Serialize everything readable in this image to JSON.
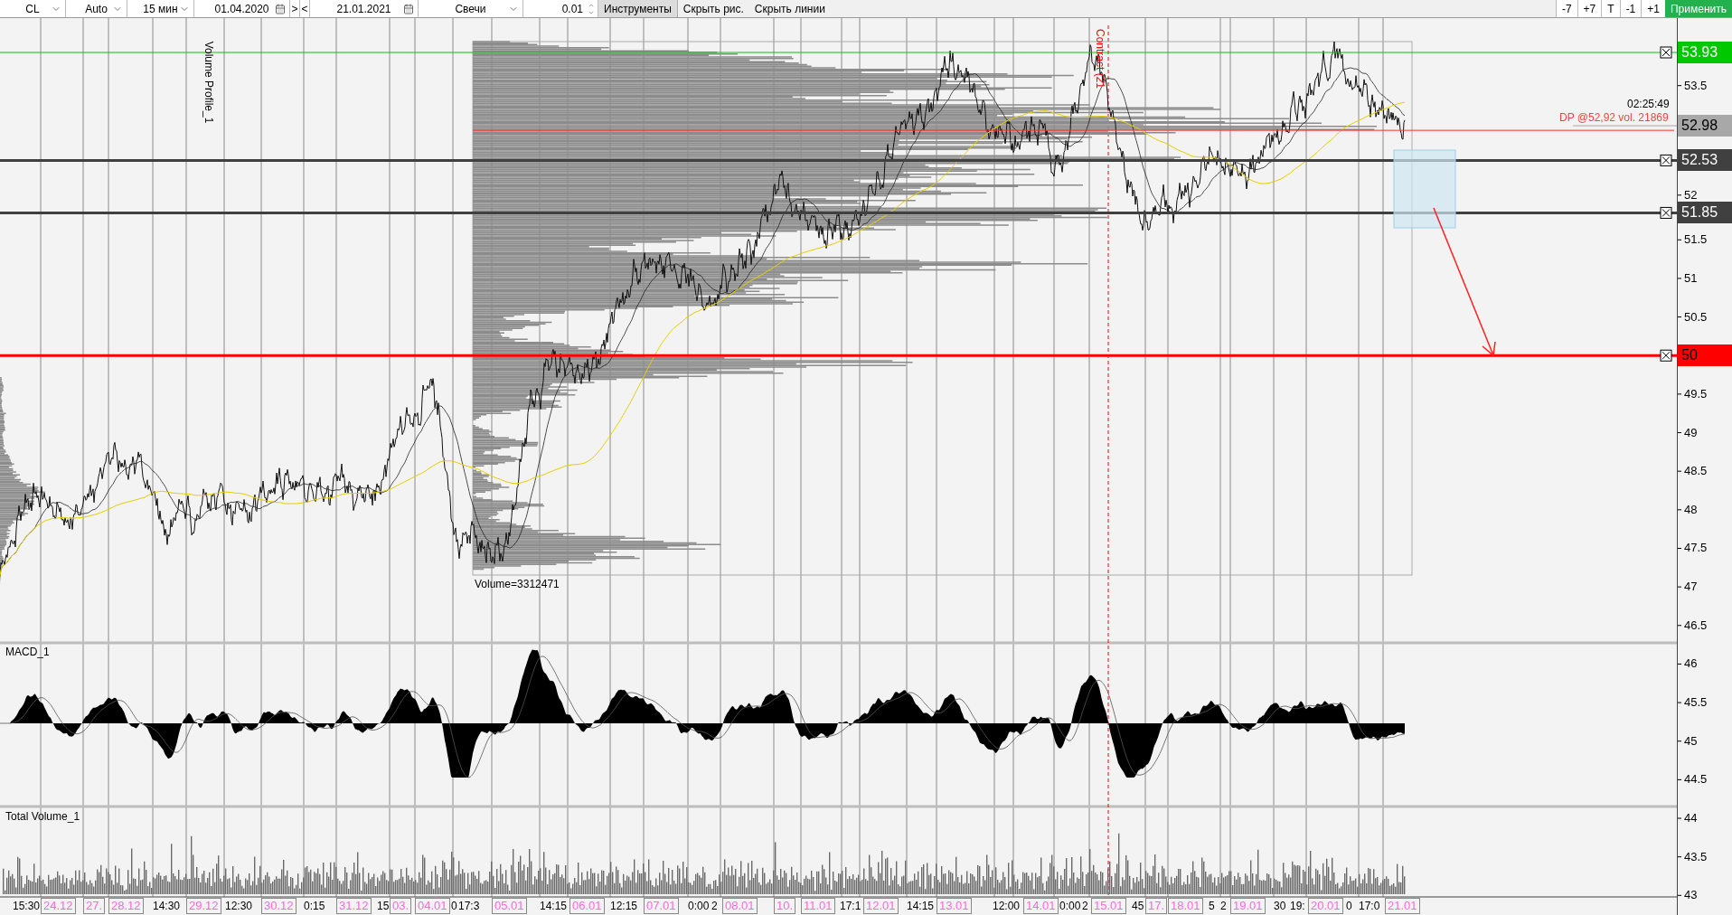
{
  "toolbar": {
    "symbol": "CL",
    "scale": "Auto",
    "timeframe": "15 мин",
    "date_from": "01.04.2020",
    "nav": [
      ">",
      "<"
    ],
    "date_to": "21.01.2021",
    "chart_type": "Свечи",
    "step": "0.01",
    "buttons": [
      "Инструменты",
      "Скрыть рис.",
      "Скрыть линии"
    ],
    "shift_buttons": [
      "-7",
      "+7",
      "T",
      "-1",
      "+1"
    ],
    "apply": "Применить"
  },
  "price_chart": {
    "indicator_label": "Volume Profile_1",
    "contract_label": "Contract (21",
    "profile_volume": "Volume=3312471",
    "timer": "02:25:49",
    "dp_label": "DP @52,92 vol. 21869"
  },
  "price_axis": {
    "ticks": [
      "53.5",
      "52",
      "51.5",
      "51",
      "50.5",
      "49.5",
      "49",
      "48.5",
      "48",
      "47.5",
      "47",
      "46.5",
      "46",
      "45.5",
      "45",
      "44.5",
      "44",
      "43.5",
      "43"
    ],
    "levels": [
      {
        "value": "53.93",
        "color": "#00c800",
        "kind": "line"
      },
      {
        "value": "52.98",
        "color": "#a8a8a8",
        "kind": "price"
      },
      {
        "value": "52.53",
        "color": "#404040",
        "kind": "line"
      },
      {
        "value": "51.85",
        "color": "#404040",
        "kind": "line"
      },
      {
        "value": "50",
        "color": "#ff0000",
        "kind": "line"
      }
    ]
  },
  "macd_panel": {
    "title": "MACD_1"
  },
  "volume_panel": {
    "title": "Total Volume_1"
  },
  "time_axis": [
    {
      "text": "15:30",
      "kind": "time"
    },
    {
      "text": "24.12",
      "kind": "date"
    },
    {
      "text": "27.",
      "kind": "date"
    },
    {
      "text": "28.12",
      "kind": "date"
    },
    {
      "text": "14:30",
      "kind": "time"
    },
    {
      "text": "29.12",
      "kind": "date"
    },
    {
      "text": "12:30",
      "kind": "time"
    },
    {
      "text": "30.12",
      "kind": "date"
    },
    {
      "text": "0:15",
      "kind": "time"
    },
    {
      "text": "31.12",
      "kind": "date"
    },
    {
      "text": "15",
      "kind": "time"
    },
    {
      "text": "03.",
      "kind": "date"
    },
    {
      "text": "04.01",
      "kind": "date"
    },
    {
      "text": "0",
      "kind": "time"
    },
    {
      "text": "17:3",
      "kind": "time"
    },
    {
      "text": "05.01",
      "kind": "date"
    },
    {
      "text": "14:15",
      "kind": "time"
    },
    {
      "text": "06.01",
      "kind": "date"
    },
    {
      "text": "12:15",
      "kind": "time"
    },
    {
      "text": "07.01",
      "kind": "date"
    },
    {
      "text": "0:00",
      "kind": "time"
    },
    {
      "text": "2",
      "kind": "time"
    },
    {
      "text": "08.01",
      "kind": "date"
    },
    {
      "text": "10.",
      "kind": "date"
    },
    {
      "text": "11.01",
      "kind": "date"
    },
    {
      "text": "17:1",
      "kind": "time"
    },
    {
      "text": "12.01",
      "kind": "date"
    },
    {
      "text": "14:15",
      "kind": "time"
    },
    {
      "text": "13.01",
      "kind": "date"
    },
    {
      "text": "12:00",
      "kind": "time"
    },
    {
      "text": "14.01",
      "kind": "date"
    },
    {
      "text": "0:00",
      "kind": "time"
    },
    {
      "text": "2",
      "kind": "time"
    },
    {
      "text": "15.01",
      "kind": "date"
    },
    {
      "text": "45",
      "kind": "time"
    },
    {
      "text": "17.",
      "kind": "date"
    },
    {
      "text": "18.01",
      "kind": "date"
    },
    {
      "text": "5",
      "kind": "time"
    },
    {
      "text": "2",
      "kind": "time"
    },
    {
      "text": "19.01",
      "kind": "date"
    },
    {
      "text": "30",
      "kind": "time"
    },
    {
      "text": "19:",
      "kind": "time"
    },
    {
      "text": "20.01",
      "kind": "date"
    },
    {
      "text": "0",
      "kind": "time"
    },
    {
      "text": "17:0",
      "kind": "time"
    },
    {
      "text": "21.01",
      "kind": "date"
    }
  ]
}
